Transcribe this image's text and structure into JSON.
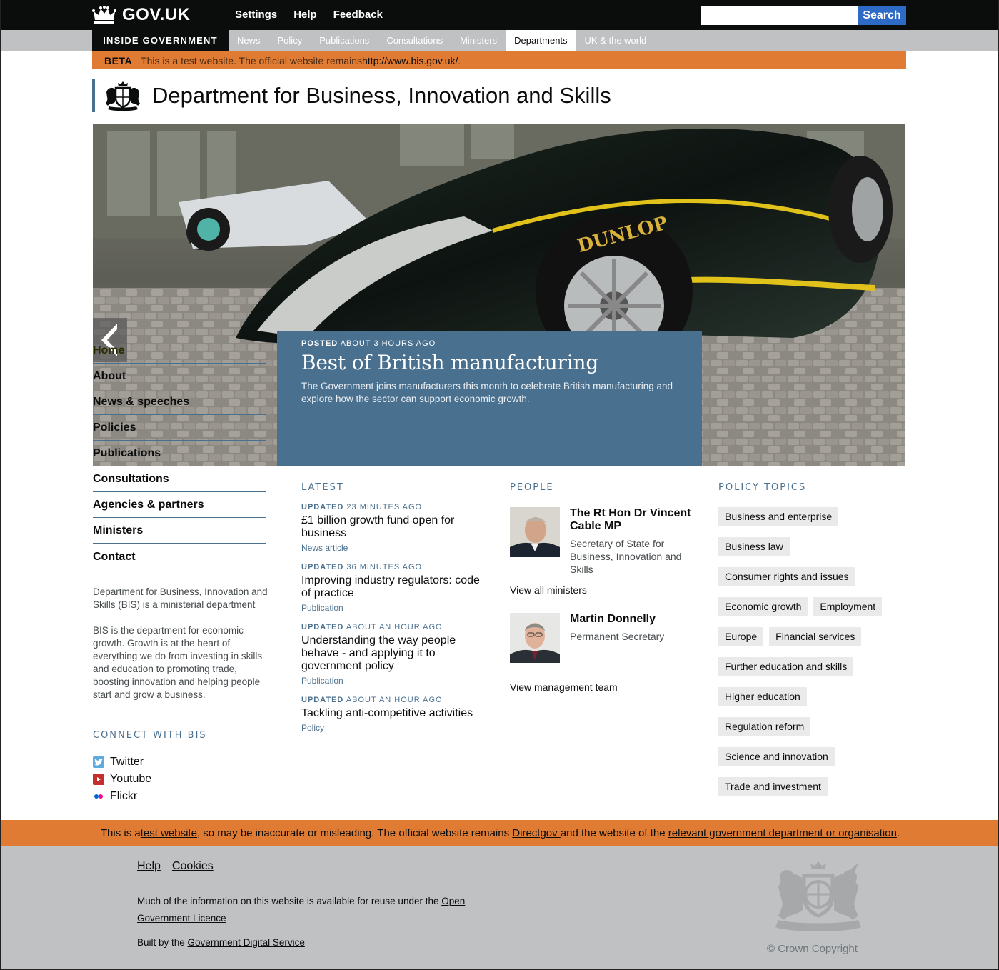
{
  "header": {
    "logo_text": "GOV.UK",
    "nav": [
      "Settings",
      "Help",
      "Feedback"
    ],
    "search_value": "",
    "search_button": "Search"
  },
  "section_nav": {
    "inside_label": "INSIDE GOVERNMENT",
    "tabs": [
      "News",
      "Policy",
      "Publications",
      "Consultations",
      "Ministers",
      "Departments",
      "UK & the world"
    ],
    "active_tab": "Departments"
  },
  "beta": {
    "tag": "BETA",
    "message": "This is a test website. The official website remains ",
    "url": "http://www.bis.gov.uk/",
    "end": "."
  },
  "org": {
    "title": "Department for Business, Innovation and Skills"
  },
  "feature": {
    "posted_label": "POSTED",
    "posted_time": "ABOUT 3 HOURS AGO",
    "title": "Best of British manufacturing",
    "summary": "The Government joins manufacturers this month to celebrate British manufacturing and explore how the sector can support economic growth."
  },
  "left_nav": [
    "Home",
    "About",
    "News & speeches",
    "Policies",
    "Publications",
    "Consultations",
    "Agencies & partners",
    "Ministers",
    "Contact"
  ],
  "about": {
    "p1": "Department for Business, Innovation and Skills (BIS) is a ministerial department",
    "p2": "BIS is the department for economic growth. Growth is at the heart of everything we do from investing in skills and education to promoting trade, boosting innovation and helping people start and grow a business."
  },
  "connect": {
    "heading": "CONNECT WITH BIS",
    "items": [
      "Twitter",
      "Youtube",
      "Flickr"
    ]
  },
  "latest": {
    "heading": "LATEST",
    "updated_label": "UPDATED",
    "items": [
      {
        "time": "23 MINUTES AGO",
        "title": "£1 billion growth fund open for business",
        "kind": "News article"
      },
      {
        "time": "36 MINUTES AGO",
        "title": "Improving industry regulators: code of practice",
        "kind": "Publication"
      },
      {
        "time": "ABOUT AN HOUR AGO",
        "title": "Understanding the way people behave - and applying it to government policy",
        "kind": "Publication"
      },
      {
        "time": "ABOUT AN HOUR AGO",
        "title": "Tackling anti-competitive activities",
        "kind": "Policy"
      }
    ]
  },
  "people": {
    "heading": "PEOPLE",
    "minister": {
      "name": "The Rt Hon Dr Vincent Cable MP",
      "role": "Secretary of State for Business, Innovation and Skills"
    },
    "view_ministers": "View all ministers",
    "official": {
      "name": "Martin Donnelly",
      "role": "Permanent Secretary"
    },
    "view_team": "View management team"
  },
  "topics": {
    "heading": "POLICY TOPICS",
    "items": [
      "Business and enterprise",
      "Business law",
      "Consumer rights and issues",
      "Economic growth",
      "Employment",
      "Europe",
      "Financial services",
      "Further education and skills",
      "Higher education",
      "Regulation reform",
      "Science and innovation",
      "Trade and investment"
    ]
  },
  "warning": {
    "a": "This is a ",
    "link1": "test website",
    "b": ", so may be inaccurate or misleading. The official website remains ",
    "link2": "Directgov ",
    "c": "and the website of the ",
    "link3": "relevant government department or organisation",
    "d": "."
  },
  "footer": {
    "links": [
      "Help",
      "Cookies"
    ],
    "reuse_text": "Much of the information on this website is available for reuse under the ",
    "reuse_link": "Open Government Licence",
    "built_text": "Built by the ",
    "built_link": "Government Digital Service",
    "copyright": "© Crown Copyright"
  },
  "colors": {
    "brand_blue": "#4a708f",
    "beta_orange": "#e07b33",
    "search_blue": "#2e6bc6"
  }
}
